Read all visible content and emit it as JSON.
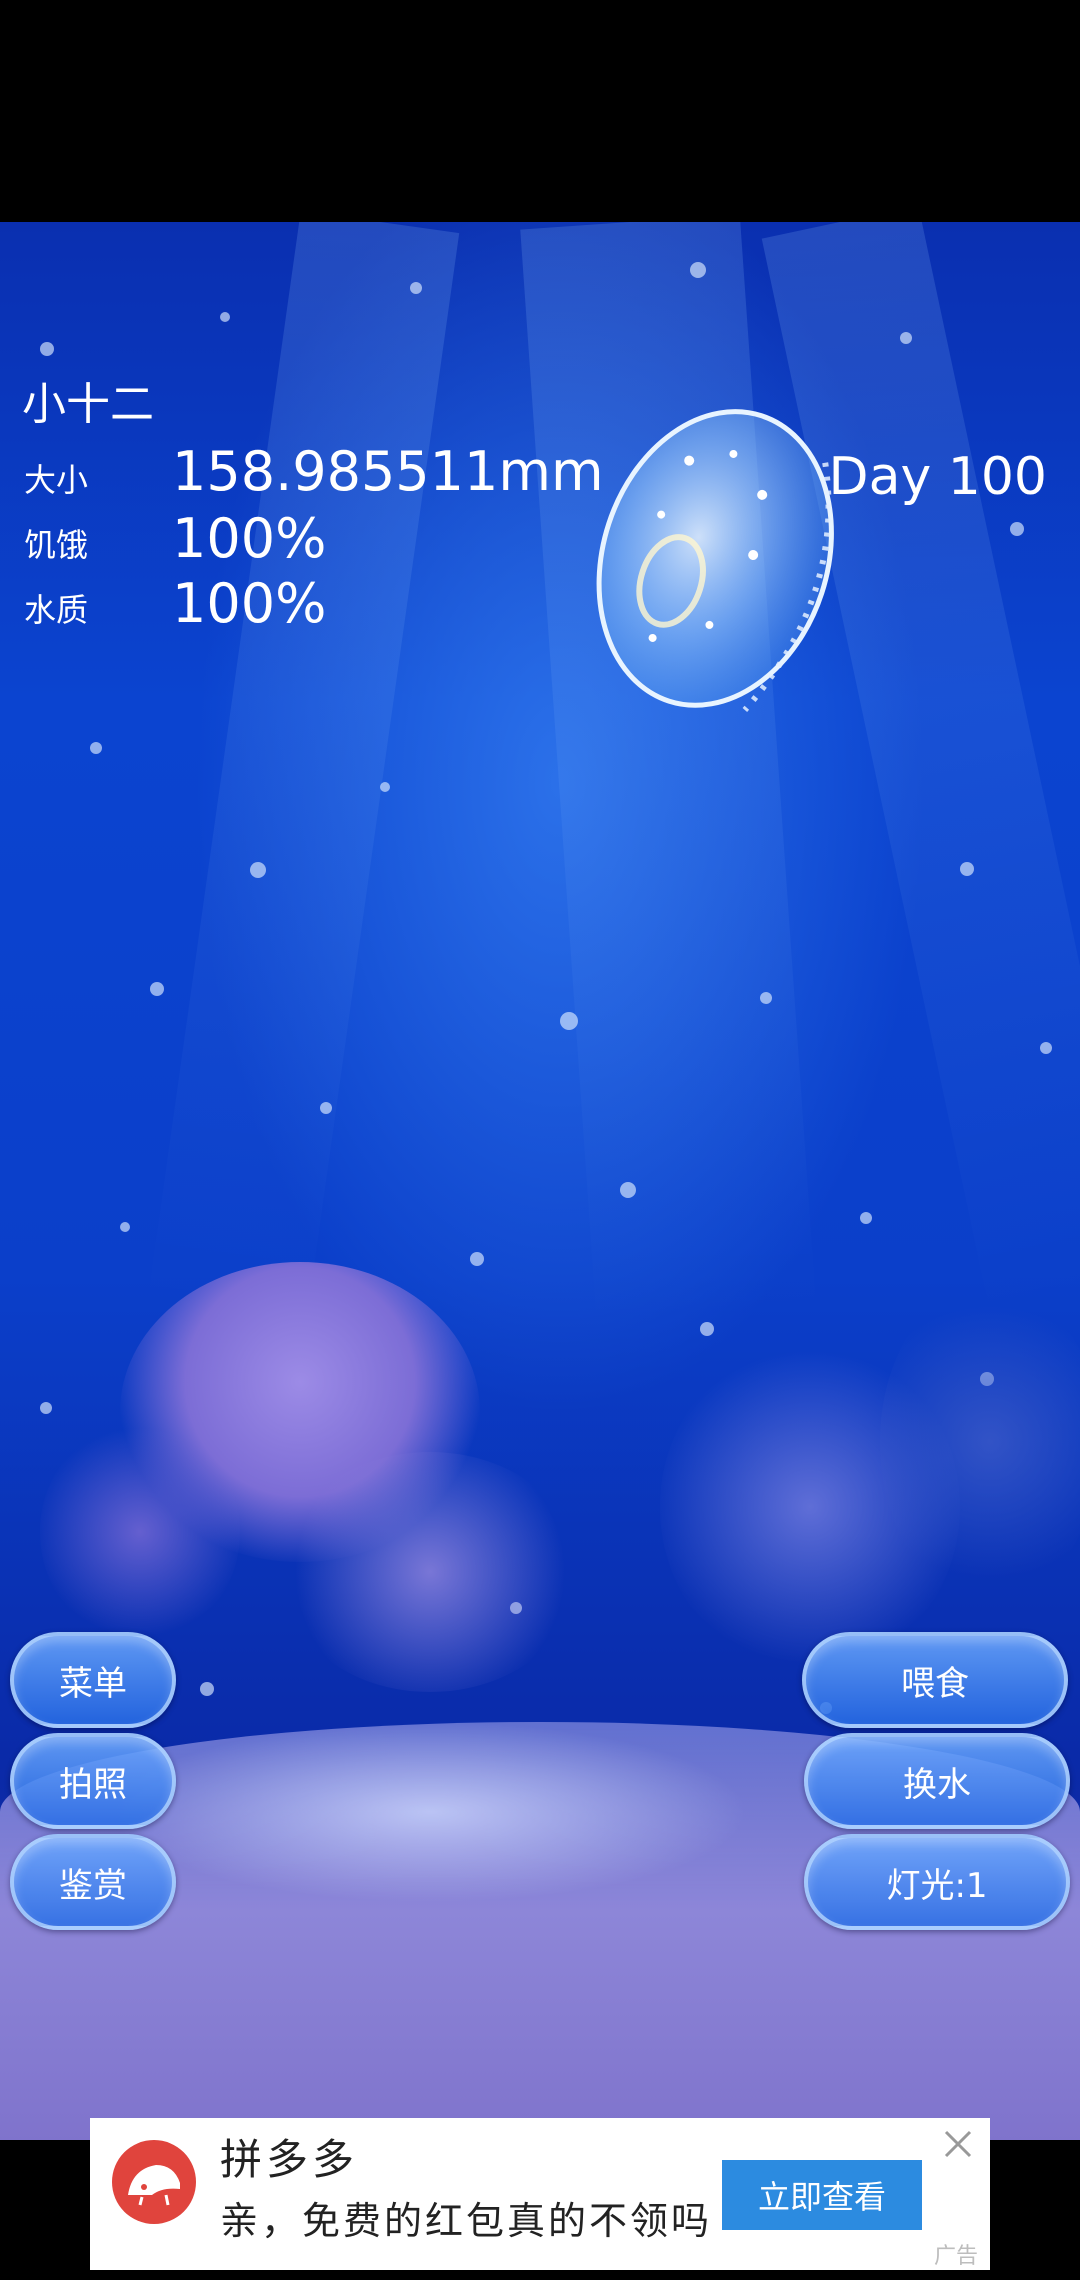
{
  "hud": {
    "name": "小十二",
    "size_label": "大小",
    "size_value": "158.985511mm",
    "hunger_label": "饥饿",
    "hunger_value": "100%",
    "water_label": "水质",
    "water_value": "100%",
    "day": "Day 100"
  },
  "buttons_left": {
    "menu": "菜单",
    "photo": "拍照",
    "appreciate": "鉴赏"
  },
  "buttons_right": {
    "feed": "喂食",
    "change_water": "换水",
    "light": "灯光:1"
  },
  "ad": {
    "title": "拼多多",
    "text": "亲，免费的红包真的不领吗",
    "cta": "立即查看",
    "tag": "广告",
    "brand_color": "#e0443d",
    "cta_color": "#2c8be0"
  },
  "icons": [
    "jellyfish-illustration",
    "close-icon",
    "pinduoduo-logo-icon"
  ]
}
